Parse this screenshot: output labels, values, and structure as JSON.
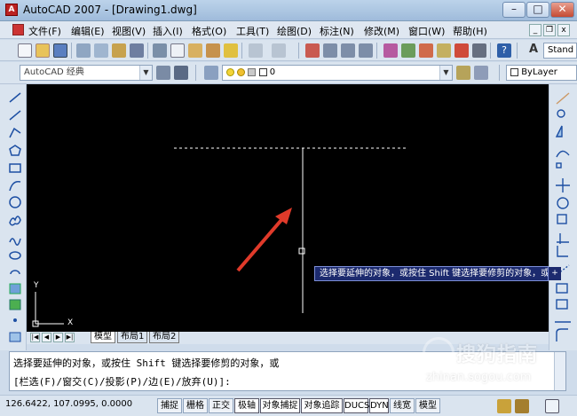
{
  "window": {
    "title": "AutoCAD 2007 - [Drawing1.dwg]",
    "app_icon_label": "A",
    "minimize": "–",
    "maximize": "□",
    "close": "✕"
  },
  "menubar": {
    "items": [
      "文件(F)",
      "编辑(E)",
      "视图(V)",
      "插入(I)",
      "格式(O)",
      "工具(T)",
      "绘图(D)",
      "标注(N)",
      "修改(M)",
      "窗口(W)",
      "帮助(H)"
    ],
    "mdi_minimize": "_",
    "mdi_restore": "❐",
    "mdi_close": "x"
  },
  "toolbar": {
    "text_style_label": "A",
    "text_style_value": "Stand",
    "workspace_value": "AutoCAD 经典",
    "layer_value": "0",
    "color_value": "ByLayer"
  },
  "canvas": {
    "ucs_y": "Y",
    "ucs_x": "X",
    "tooltip_text": "选择要延伸的对象，或按住 Shift 键选择要修剪的对象，或",
    "tooltip_icon": "+"
  },
  "tabs": {
    "nav": [
      "|◀",
      "◀",
      "▶",
      "▶|"
    ],
    "items": [
      "模型",
      "布局1",
      "布局2"
    ]
  },
  "command": {
    "line1": "选择要延伸的对象，或按住 Shift 键选择要修剪的对象，或",
    "line2": "[栏选(F)/窗交(C)/投影(P)/边(E)/放弃(U)]:"
  },
  "status": {
    "coords": "126.6422,  107.0995, 0.0000",
    "buttons": [
      "捕捉",
      "栅格",
      "正交",
      "极轴",
      "对象捕捉",
      "对象追踪",
      "DUCS",
      "DYN",
      "线宽",
      "模型"
    ]
  },
  "watermark": {
    "text": "搜狗指南",
    "sub": "zhinan.sogou.com"
  },
  "colors": {
    "canvas": "#000000",
    "arrow": "#e03a2a",
    "tooltip_bg": "#1c2a6e"
  }
}
